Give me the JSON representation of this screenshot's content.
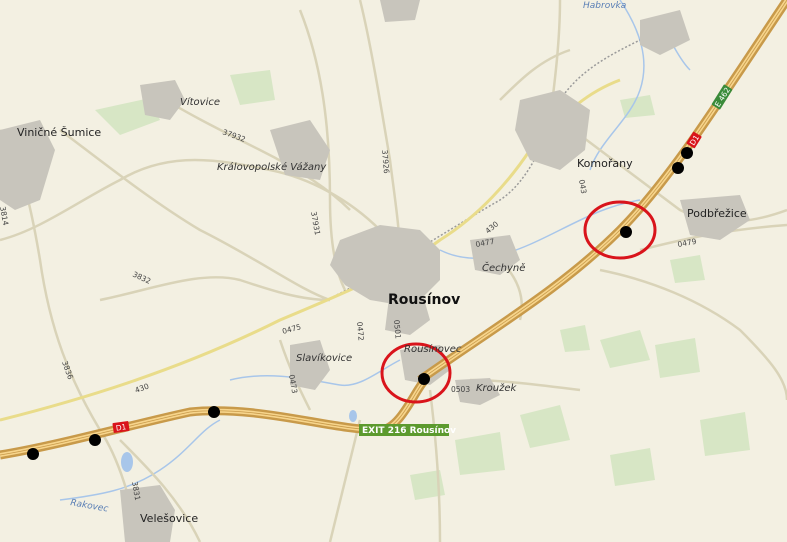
{
  "map": {
    "places": {
      "vinicne_sumice": "Viničné Šumice",
      "vitovice": "Vítovice",
      "kralovopolske_vazany": "Královopolské Vážany",
      "komorany": "Komořany",
      "podbrezice": "Podbřežice",
      "rousinov": "Rousínov",
      "cechyne": "Čechyně",
      "slavikovice": "Slavíkovice",
      "rousinovec": "Rousínovec",
      "kruzek": "Kroužek",
      "velesovice": "Velešovice",
      "habrovka": "Habrovka",
      "rakovec": "Rakovec"
    },
    "roads": {
      "d1": "D1",
      "e462": "E 462",
      "r430a": "430",
      "r430b": "430",
      "r3832": "3832",
      "r3836": "3836",
      "r3831": "3831",
      "r37932": "37932",
      "r37926": "37926",
      "r37931": "37931",
      "r0475": "0475",
      "r0471": "0471",
      "r0472": "0472",
      "r0473": "0473",
      "r0479": "0479",
      "r0503": "0503",
      "r0501": "0501",
      "r0477": "0477",
      "r043": "043",
      "r3814": "3814"
    },
    "exit_label": "EXIT 216 Rousínov",
    "colors": {
      "background": "#f3f0e2",
      "motorway": "#c89a4a",
      "motorway_center": "#f7d58c",
      "road": "#d9d3b8",
      "built_up": "#c8c5bc",
      "forest": "#d7e6c5",
      "water": "#a8c6ea",
      "railway": "#9a9a9a",
      "highlight_circle": "#d9141b",
      "exit_badge": "#5c9a2e"
    }
  }
}
